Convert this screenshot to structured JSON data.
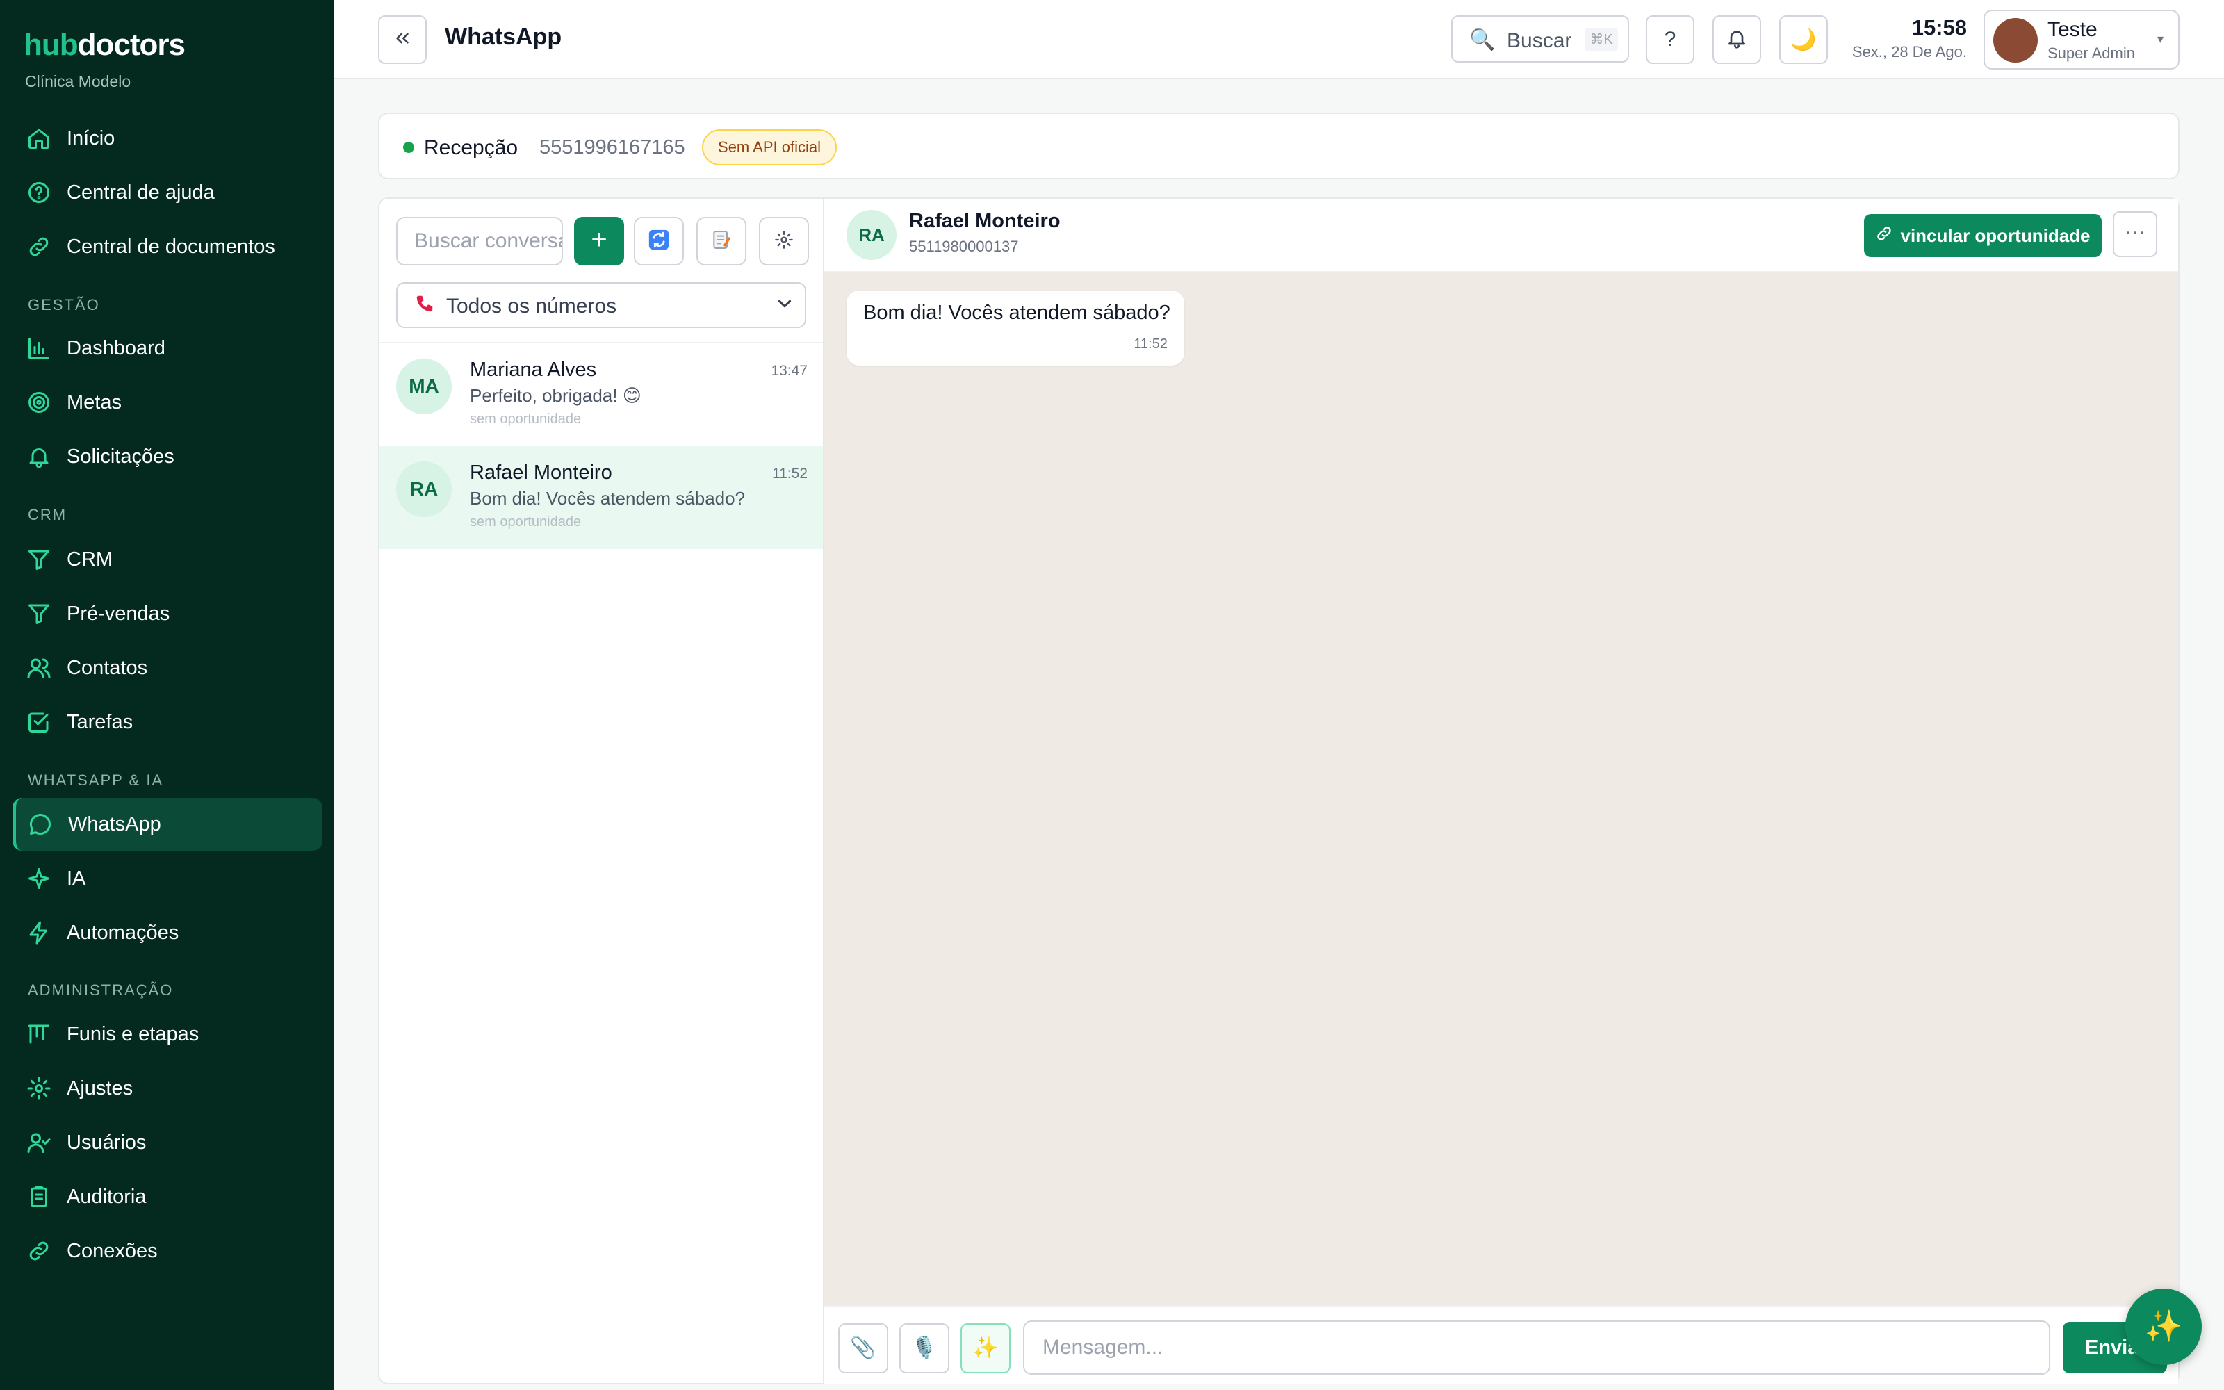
{
  "brand": {
    "logo_part1": "hub",
    "logo_part2": "doctors",
    "clinic": "Clínica Modelo"
  },
  "sidebar": {
    "items_top": [
      {
        "label": "Início",
        "icon": "home-icon"
      },
      {
        "label": "Central de ajuda",
        "icon": "help-circle-icon"
      },
      {
        "label": "Central de documentos",
        "icon": "link-icon"
      }
    ],
    "sections": [
      {
        "title": "GESTÃO",
        "items": [
          {
            "label": "Dashboard",
            "icon": "bar-chart-icon"
          },
          {
            "label": "Metas",
            "icon": "target-icon"
          },
          {
            "label": "Solicitações",
            "icon": "bell-icon"
          }
        ]
      },
      {
        "title": "CRM",
        "items": [
          {
            "label": "CRM",
            "icon": "filter-icon"
          },
          {
            "label": "Pré-vendas",
            "icon": "filter-icon"
          },
          {
            "label": "Contatos",
            "icon": "users-icon"
          },
          {
            "label": "Tarefas",
            "icon": "check-square-icon"
          }
        ]
      },
      {
        "title": "WHATSAPP & IA",
        "items": [
          {
            "label": "WhatsApp",
            "icon": "message-circle-icon",
            "active": true
          },
          {
            "label": "IA",
            "icon": "sparkle-icon"
          },
          {
            "label": "Automações",
            "icon": "zap-icon"
          }
        ]
      },
      {
        "title": "ADMINISTRAÇÃO",
        "items": [
          {
            "label": "Funis e etapas",
            "icon": "kanban-icon"
          },
          {
            "label": "Ajustes",
            "icon": "settings-icon"
          },
          {
            "label": "Usuários",
            "icon": "user-check-icon"
          },
          {
            "label": "Auditoria",
            "icon": "clipboard-icon"
          },
          {
            "label": "Conexões",
            "icon": "link-icon"
          }
        ]
      }
    ]
  },
  "header": {
    "title": "WhatsApp",
    "search_label": "Buscar",
    "search_shortcut": "⌘K",
    "help_label": "?",
    "time": "15:58",
    "date": "Sex., 28 De Ago.",
    "user_name": "Teste",
    "user_role": "Super Admin"
  },
  "connection": {
    "name": "Recepção",
    "number": "5551996167165",
    "badge": "Sem API oficial",
    "status_color": "#16a34a"
  },
  "conversations": {
    "search_placeholder": "Buscar conversa",
    "add_label": "+",
    "number_filter": "Todos os números",
    "items": [
      {
        "initials": "MA",
        "name": "Mariana Alves",
        "time": "13:47",
        "preview": "Perfeito, obrigada! 😊",
        "opportunity": "sem oportunidade",
        "selected": false
      },
      {
        "initials": "RA",
        "name": "Rafael Monteiro",
        "time": "11:52",
        "preview": "Bom dia! Vocês atendem sábado?",
        "opportunity": "sem oportunidade",
        "selected": true
      }
    ]
  },
  "chat": {
    "contact_initials": "RA",
    "contact_name": "Rafael Monteiro",
    "contact_phone": "5511980000137",
    "link_button": "vincular oportunidade",
    "more_label": "···",
    "messages": [
      {
        "text": "Bom dia! Vocês atendem sábado?",
        "time": "11:52",
        "direction": "incoming"
      }
    ],
    "composer_placeholder": "Mensagem...",
    "send_label": "Enviar"
  },
  "colors": {
    "accent": "#0d8a5d",
    "sidebar_bg": "#04291f",
    "chat_bg": "#efeae4"
  }
}
